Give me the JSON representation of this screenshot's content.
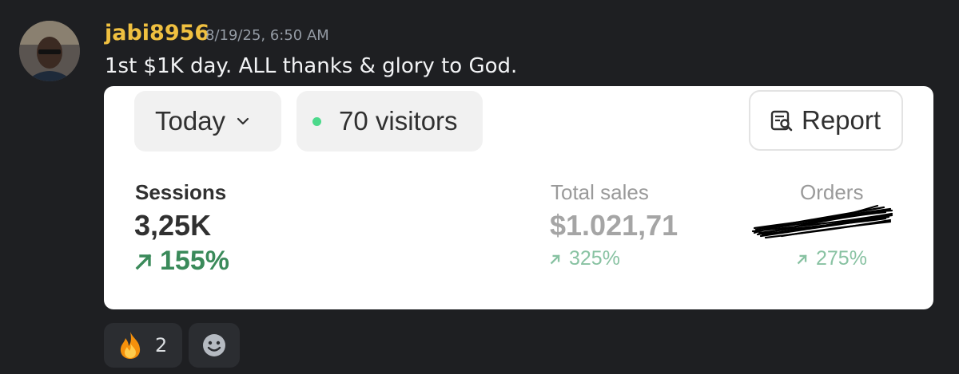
{
  "message": {
    "username": "jabi8956",
    "timestamp": "8/19/25, 6:50 AM",
    "text": "1st $1K day. ALL thanks & glory to God.",
    "username_color": "#f0c040"
  },
  "card": {
    "period_label": "Today",
    "visitors_label": "70 visitors",
    "visitors_dot_color": "#4cd98b",
    "report_label": "Report",
    "metrics": {
      "sessions": {
        "label": "Sessions",
        "value": "3,25K",
        "change": "155%"
      },
      "total_sales": {
        "label": "Total sales",
        "value": "$1.021,71",
        "change": "325%"
      },
      "orders": {
        "label": "Orders",
        "value_redacted": true,
        "change": "275%"
      }
    },
    "positive_color": "#3a8a5a"
  },
  "reactions": [
    {
      "icon": "fire-emoji",
      "count": "2"
    },
    {
      "icon": "add-reaction-icon"
    }
  ]
}
